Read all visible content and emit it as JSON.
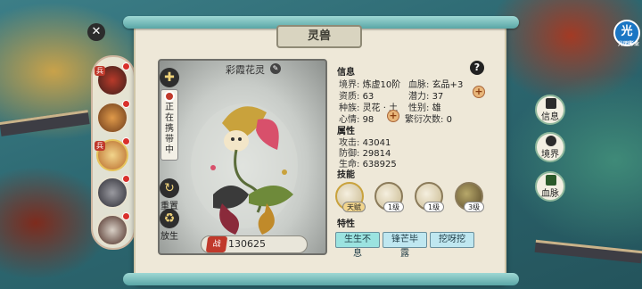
{
  "panel_title": "灵兽",
  "portrait": {
    "name": "彩霞花灵",
    "status_label": "正在携带中",
    "reset_label": "重置",
    "release_label": "放生"
  },
  "power": {
    "badge": "战",
    "value": "130625"
  },
  "info": {
    "header": "信息",
    "fields": [
      {
        "label": "境界:",
        "value": "炼虚10阶"
      },
      {
        "label": "血脉:",
        "value": "玄品+3"
      },
      {
        "label": "资质:",
        "value": "63"
      },
      {
        "label": "潜力:",
        "value": "37"
      },
      {
        "label": "种族:",
        "value": "灵花 · 土"
      },
      {
        "label": "性别:",
        "value": "雄"
      },
      {
        "label": "心情:",
        "value": "98"
      },
      {
        "label": "繁衍次数:",
        "value": "0"
      }
    ]
  },
  "attributes": {
    "header": "属性",
    "fields": [
      {
        "label": "攻击:",
        "value": "43041"
      },
      {
        "label": "防御:",
        "value": "29814"
      },
      {
        "label": "生命:",
        "value": "638925"
      }
    ]
  },
  "skills": {
    "header": "技能",
    "items": [
      {
        "level": "天赋",
        "icon": "flower-skill-icon"
      },
      {
        "level": "1级",
        "icon": "wing-skill-icon"
      },
      {
        "level": "1级",
        "icon": "feather-skill-icon"
      },
      {
        "level": "3级",
        "icon": "bloom-skill-icon"
      }
    ]
  },
  "traits": {
    "header": "特性",
    "items": [
      "生生不息",
      "锋芒毕露",
      "挖呀挖"
    ],
    "colors": [
      "#9be3e0",
      "#bfe7f0",
      "#bfe7f0"
    ]
  },
  "right_tabs": [
    "信息",
    "境界",
    "血脉"
  ],
  "beast_list": {
    "tags": [
      "兵",
      "兵"
    ]
  },
  "corner_badge": {
    "char": "光",
    "caption": "光明影业"
  },
  "colors": {
    "scroll_bg": "#eee8d8",
    "accent_red": "#c0392b",
    "rod": "#7cc1c0"
  }
}
